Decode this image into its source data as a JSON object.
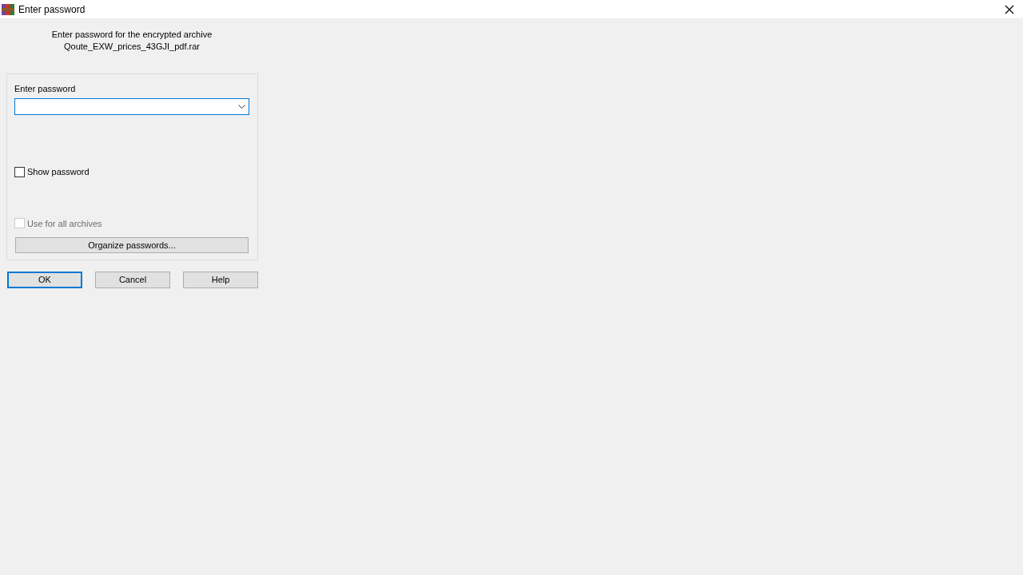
{
  "window": {
    "title": "Enter password"
  },
  "prompt": {
    "line_1": "Enter password for the encrypted archive",
    "line_2": "Qoute_EXW_prices_43GJI_pdf.rar"
  },
  "password_field": {
    "label": "Enter password"
  },
  "checkboxes": [
    {
      "label": "Show password",
      "checked": false,
      "disabled": false
    },
    {
      "label": "Use for all archives",
      "checked": false,
      "disabled": true
    }
  ],
  "organize_button": "Organize passwords...",
  "buttons": [
    {
      "label": "OK",
      "selected": true
    },
    {
      "label": "Cancel",
      "selected": false
    },
    {
      "label": "Help",
      "selected": false
    }
  ]
}
